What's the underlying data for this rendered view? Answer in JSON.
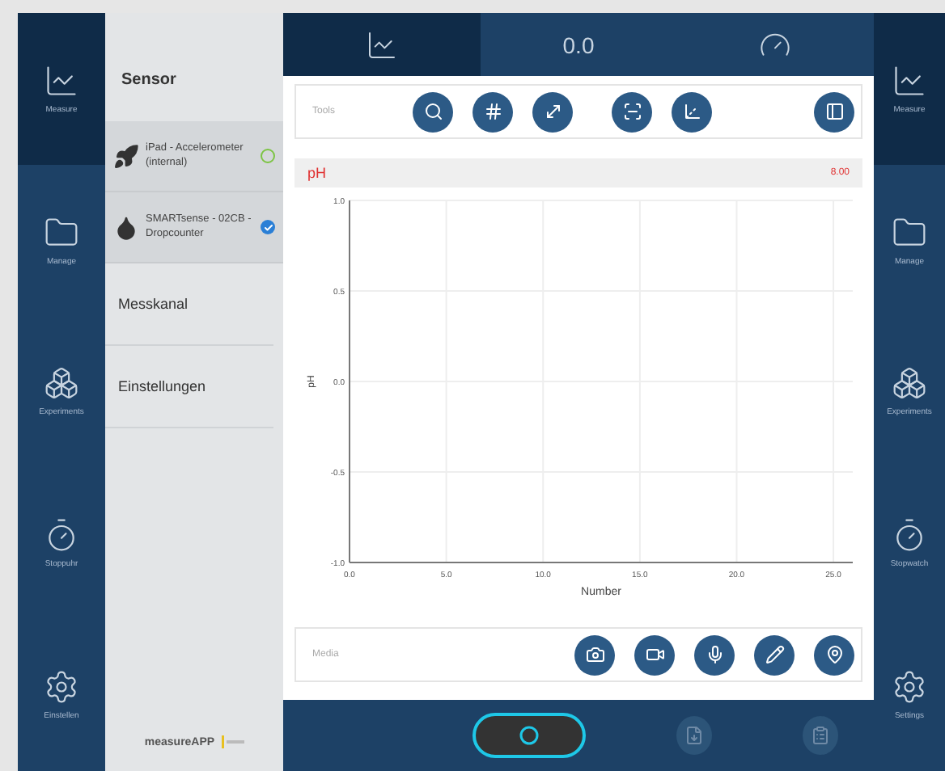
{
  "nav_left": [
    {
      "label": "Measure",
      "selected": true
    },
    {
      "label": "Manage",
      "selected": false
    },
    {
      "label": "Experiments",
      "selected": false
    },
    {
      "label": "Stoppuhr",
      "selected": false
    },
    {
      "label": "Einstellen",
      "selected": false
    }
  ],
  "sensor_panel": {
    "title": "Sensor",
    "sensors": [
      {
        "name": "iPad - Accelerometer (internal)",
        "selected": false
      },
      {
        "name": "SMARTsense - 02CB - Dropcounter",
        "selected": true
      }
    ],
    "items": [
      "Messkanal",
      "Einstellungen"
    ],
    "logo": "measureAPP"
  },
  "tabs": [
    {
      "kind": "icon",
      "selected": true
    },
    {
      "kind": "text",
      "label": "0.0",
      "selected": false
    },
    {
      "kind": "icon",
      "selected": false
    }
  ],
  "tools": {
    "label": "Tools"
  },
  "channel": {
    "name": "pH",
    "value": "8.00"
  },
  "chart_data": {
    "type": "line",
    "grid": true,
    "xlabel": "Number",
    "ylabel": "pH",
    "xlim": [
      0,
      26
    ],
    "ylim": [
      -1,
      1
    ],
    "xticks": [
      {
        "value": 0,
        "label": "0.0"
      },
      {
        "value": 5,
        "label": "5.0"
      },
      {
        "value": 10,
        "label": "10.0"
      },
      {
        "value": 15,
        "label": "15.0"
      },
      {
        "value": 20,
        "label": "20.0"
      },
      {
        "value": 25,
        "label": "25.0"
      }
    ],
    "yticks": [
      {
        "value": 1,
        "label": "1.0"
      },
      {
        "value": 0.5,
        "label": "0.5"
      },
      {
        "value": 0,
        "label": "0.0"
      },
      {
        "value": -0.5,
        "label": "-0.5"
      },
      {
        "value": -1,
        "label": "-1.0"
      }
    ]
  },
  "media": {
    "label": "Media"
  },
  "bottom_bar": [
    {
      "kind": "record",
      "disabled": false
    },
    {
      "kind": "export",
      "disabled": true
    },
    {
      "kind": "clipboard",
      "disabled": true
    }
  ],
  "nav_right": [
    {
      "label": "Measure",
      "selected": true
    },
    {
      "label": "Manage",
      "selected": false
    },
    {
      "label": "Experiments",
      "selected": false
    },
    {
      "label": "Stopwatch",
      "selected": false
    },
    {
      "label": "Settings",
      "selected": false
    }
  ]
}
